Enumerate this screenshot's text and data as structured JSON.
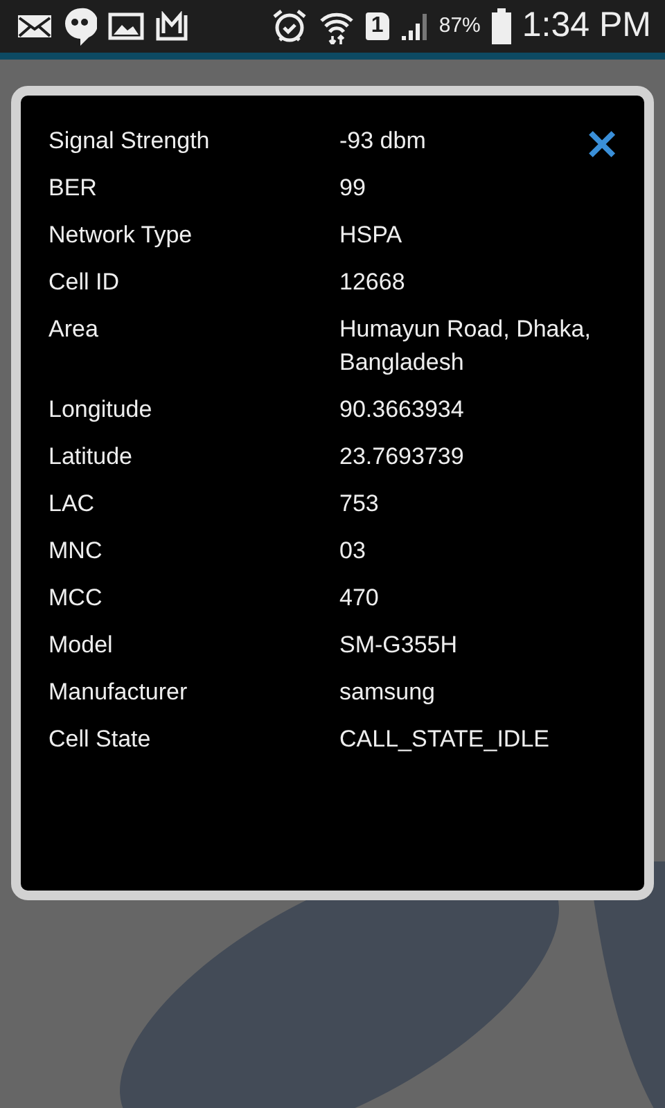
{
  "status_bar": {
    "sim_slot": "1",
    "battery_text": "87%",
    "time": "1:34 PM"
  },
  "dialog": {
    "close_icon": "✕",
    "rows": [
      {
        "label": "Signal Strength",
        "value": "-93 dbm"
      },
      {
        "label": "BER",
        "value": "99"
      },
      {
        "label": "Network Type",
        "value": "HSPA"
      },
      {
        "label": "Cell ID",
        "value": "12668"
      },
      {
        "label": "Area",
        "value": "Humayun Road, Dhaka, Bangladesh"
      },
      {
        "label": "Longitude",
        "value": "90.3663934"
      },
      {
        "label": "Latitude",
        "value": "23.7693739"
      },
      {
        "label": "LAC",
        "value": "753"
      },
      {
        "label": "MNC",
        "value": "03"
      },
      {
        "label": "MCC",
        "value": "470"
      },
      {
        "label": "Model",
        "value": "SM-G355H"
      },
      {
        "label": "Manufacturer",
        "value": "samsung"
      },
      {
        "label": "Cell State",
        "value": "CALL_STATE_IDLE"
      }
    ]
  }
}
